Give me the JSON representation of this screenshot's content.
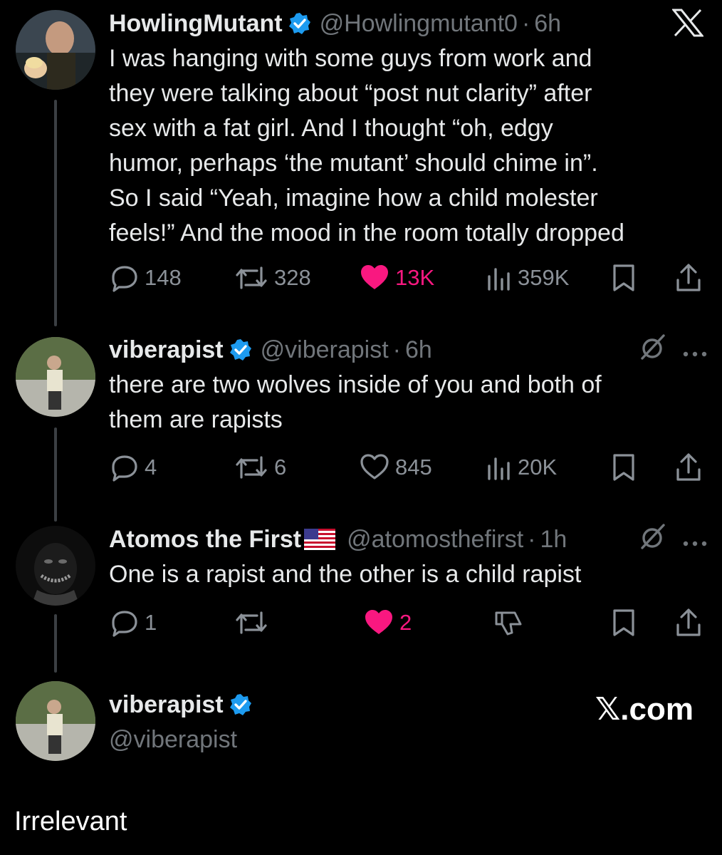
{
  "x_logo_icon": "x-logo-icon",
  "posts": [
    {
      "name": "HowlingMutant",
      "handle": "@Howlingmutant0",
      "dot": "·",
      "time": "6h",
      "text_lines": [
        "I was hanging with some guys from work and",
        "they were talking about “post nut clarity” after",
        "sex with a fat girl. And I thought “oh, edgy",
        "humor, perhaps ‘the mutant’ should chime in”.",
        "So I said “Yeah, imagine how a child molester",
        "feels!” And the mood in the room totally dropped"
      ],
      "replies": "148",
      "reposts": "328",
      "likes": "13K",
      "liked": true,
      "views": "359K"
    },
    {
      "name": "viberapist",
      "handle": "@viberapist",
      "dot": "·",
      "time": "6h",
      "text_lines": [
        "there are two wolves inside of you and both of",
        "them are rapists"
      ],
      "replies": "4",
      "reposts": "6",
      "likes": "845",
      "liked": false,
      "views": "20K"
    },
    {
      "name": "Atomos the First",
      "flag": "🇺🇸",
      "handle": "@atomosthefirst",
      "dot": "·",
      "time": "1h",
      "text_lines": [
        "One is a rapist and the other is a child rapist"
      ],
      "replies": "1",
      "reposts": "",
      "likes": "2",
      "liked": true
    }
  ],
  "profile": {
    "name": "viberapist",
    "handle": "@viberapist"
  },
  "watermark": "𝕏.com",
  "footer_caption": "Irrelevant",
  "colors": {
    "background": "#000000",
    "muted": "#71767b",
    "like_pink": "#f91880",
    "verified_blue": "#1d9bf0"
  }
}
